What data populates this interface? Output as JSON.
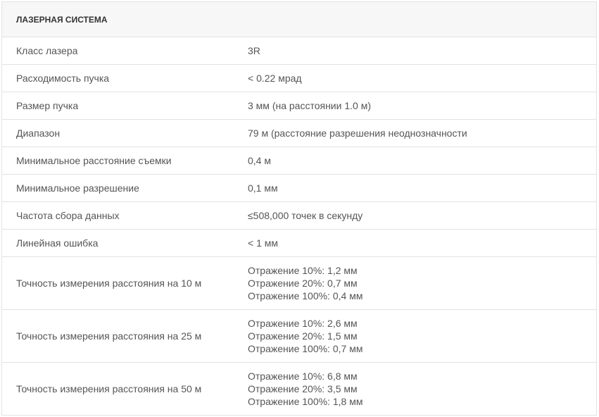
{
  "section": {
    "title": "ЛАЗЕРНАЯ СИСТЕМА"
  },
  "rows": [
    {
      "label": "Класс лазера",
      "value": "3R"
    },
    {
      "label": "Расходимость пучка",
      "value": "< 0.22 мрад"
    },
    {
      "label": "Размер пучка",
      "value": "3 мм (на расстоянии 1.0 м)"
    },
    {
      "label": "Диапазон",
      "value": "79 м (расстояние разрешения неоднозначности"
    },
    {
      "label": "Минимальное расстояние съемки",
      "value": "0,4 м"
    },
    {
      "label": "Минимальное разрешение",
      "value": "0,1 мм"
    },
    {
      "label": "Частота сбора данных",
      "value": "≤508,000 точек в секунду"
    },
    {
      "label": "Линейная ошибка",
      "value": "< 1 мм"
    }
  ],
  "accuracy_rows": [
    {
      "label": "Точность измерения расстояния на 10 м",
      "lines": [
        "Отражение 10%: 1,2 мм",
        "Отражение 20%: 0,7 мм",
        "Отражение 100%: 0,4 мм"
      ]
    },
    {
      "label": "Точность измерения расстояния на 25 м",
      "lines": [
        "Отражение 10%: 2,6 мм",
        "Отражение 20%: 1,5 мм",
        "Отражение 100%: 0,7 мм"
      ]
    },
    {
      "label": "Точность измерения расстояния на 50 м",
      "lines": [
        "Отражение 10%: 6,8 мм",
        "Отражение 20%: 3,5 мм",
        "Отражение 100%: 1,8 мм"
      ]
    }
  ]
}
